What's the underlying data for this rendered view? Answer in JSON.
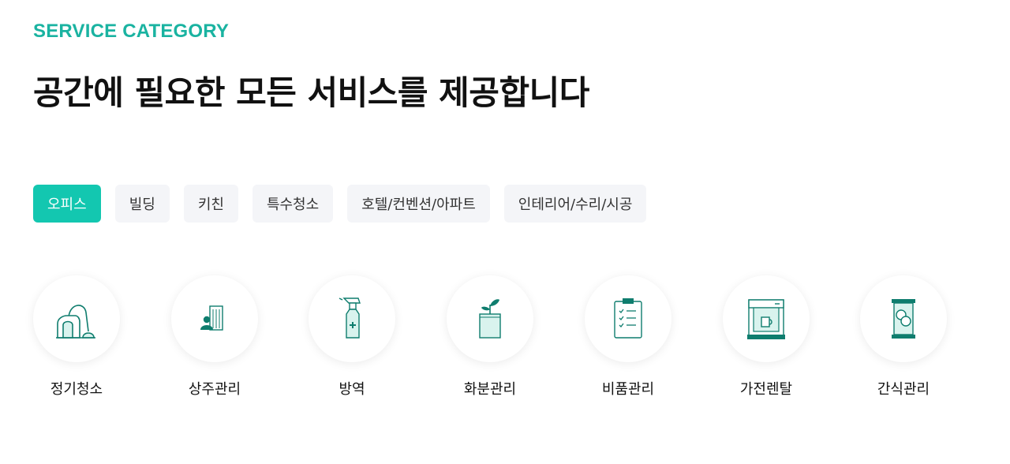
{
  "section": {
    "eyebrow": "SERVICE CATEGORY",
    "title": "공간에 필요한 모든 서비스를 제공합니다"
  },
  "tabs": [
    {
      "label": "오피스",
      "active": true
    },
    {
      "label": "빌딩",
      "active": false
    },
    {
      "label": "키친",
      "active": false
    },
    {
      "label": "특수청소",
      "active": false
    },
    {
      "label": "호텔/컨벤션/아파트",
      "active": false
    },
    {
      "label": "인테리어/수리/시공",
      "active": false
    }
  ],
  "services": [
    {
      "label": "정기청소",
      "icon": "vacuum-cleaner-icon"
    },
    {
      "label": "상주관리",
      "icon": "building-staff-icon"
    },
    {
      "label": "방역",
      "icon": "disinfectant-spray-icon"
    },
    {
      "label": "화분관리",
      "icon": "plant-pot-icon"
    },
    {
      "label": "비품관리",
      "icon": "checklist-clipboard-icon"
    },
    {
      "label": "가전렌탈",
      "icon": "coffee-machine-icon"
    },
    {
      "label": "간식관리",
      "icon": "snack-pack-icon"
    }
  ],
  "colors": {
    "accent": "#13c7b0",
    "eyebrow": "#1ab3a1",
    "icon_stroke": "#0f7d6e",
    "icon_fill": "#d9f3ee",
    "tab_bg": "#f4f5f8"
  }
}
